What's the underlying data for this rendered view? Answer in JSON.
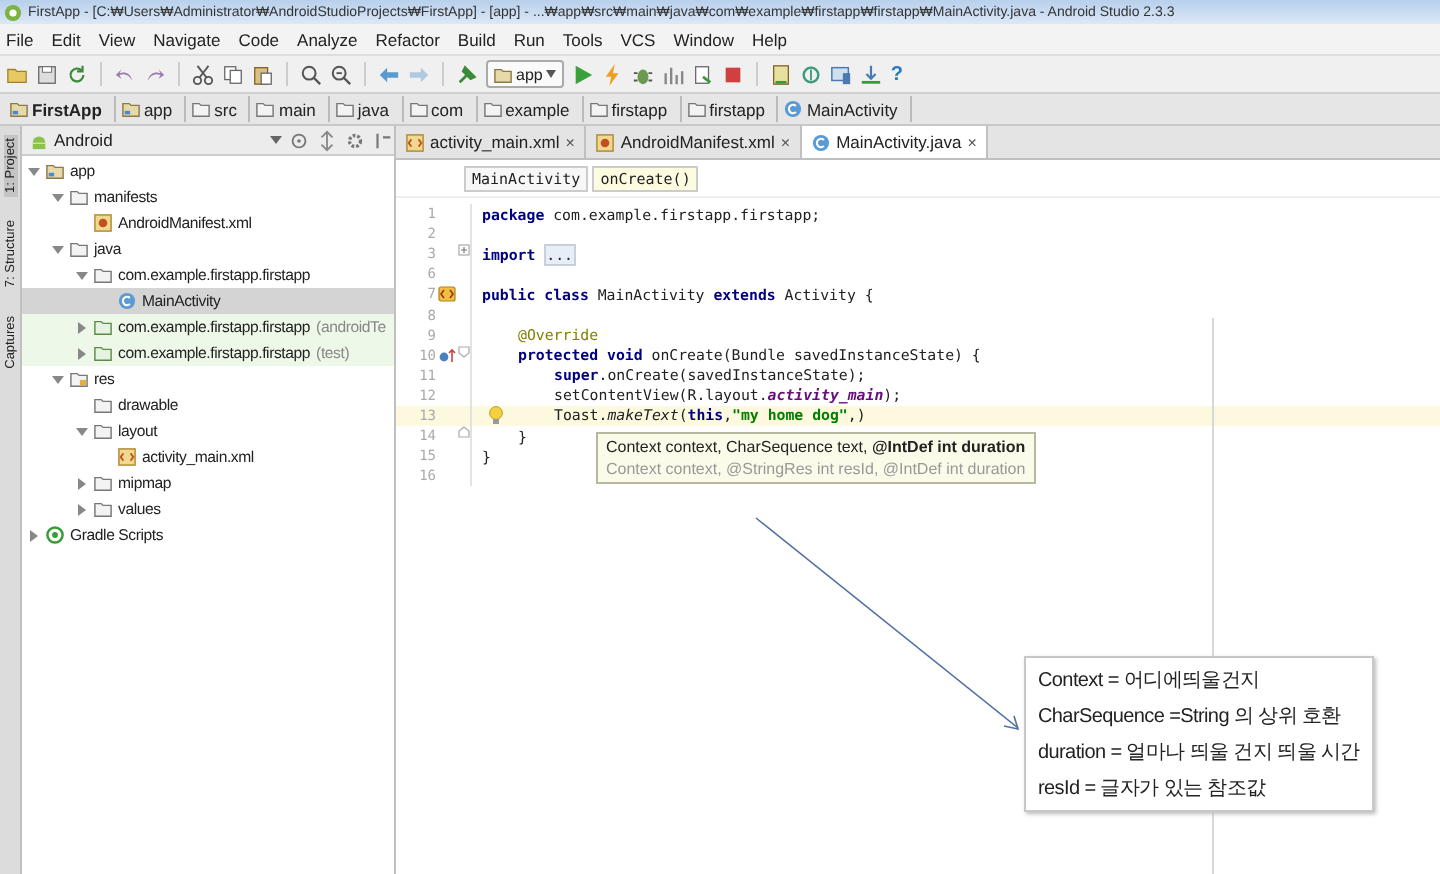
{
  "window": {
    "title": "FirstApp - [C:₩Users₩Administrator₩AndroidStudioProjects₩FirstApp] - [app] - ...₩app₩src₩main₩java₩com₩example₩firstapp₩firstapp₩MainActivity.java - Android Studio 2.3.3"
  },
  "menu": [
    "File",
    "Edit",
    "View",
    "Navigate",
    "Code",
    "Analyze",
    "Refactor",
    "Build",
    "Run",
    "Tools",
    "VCS",
    "Window",
    "Help"
  ],
  "toolbar": {
    "run_config": "app",
    "help": "?"
  },
  "breadcrumb": [
    {
      "label": "FirstApp",
      "kind": "module"
    },
    {
      "label": "app",
      "kind": "module"
    },
    {
      "label": "src",
      "kind": "folder"
    },
    {
      "label": "main",
      "kind": "folder"
    },
    {
      "label": "java",
      "kind": "folder"
    },
    {
      "label": "com",
      "kind": "folder"
    },
    {
      "label": "example",
      "kind": "folder"
    },
    {
      "label": "firstapp",
      "kind": "folder"
    },
    {
      "label": "firstapp",
      "kind": "folder"
    },
    {
      "label": "MainActivity",
      "kind": "class"
    }
  ],
  "side_tabs": [
    {
      "label": "1: Project",
      "selected": true
    },
    {
      "label": "7: Structure",
      "selected": false
    },
    {
      "label": "Captures",
      "selected": false
    }
  ],
  "project": {
    "view": "Android",
    "tree": [
      {
        "label": "app",
        "kind": "module",
        "expanded": true,
        "selected": false,
        "children": [
          {
            "label": "manifests",
            "kind": "folder",
            "expanded": true,
            "selected": false,
            "children": [
              {
                "label": "AndroidManifest.xml",
                "kind": "manifest",
                "selected": false
              }
            ]
          },
          {
            "label": "java",
            "kind": "folder",
            "expanded": true,
            "selected": false,
            "children": [
              {
                "label": "com.example.firstapp.firstapp",
                "kind": "folder",
                "expanded": true,
                "selected": false,
                "children": [
                  {
                    "label": "MainActivity",
                    "kind": "class",
                    "selected": true
                  }
                ]
              },
              {
                "label": "com.example.firstapp.firstapp",
                "suffix": "(androidTe",
                "kind": "test_folder",
                "expanded": false,
                "selected": false
              },
              {
                "label": "com.example.firstapp.firstapp",
                "suffix": "(test)",
                "kind": "test_folder",
                "expanded": false,
                "selected": false
              }
            ]
          },
          {
            "label": "res",
            "kind": "res_folder",
            "expanded": true,
            "selected": false,
            "children": [
              {
                "label": "drawable",
                "kind": "folder",
                "selected": false
              },
              {
                "label": "layout",
                "kind": "folder",
                "expanded": true,
                "selected": false,
                "children": [
                  {
                    "label": "activity_main.xml",
                    "kind": "layout",
                    "selected": false
                  }
                ]
              },
              {
                "label": "mipmap",
                "kind": "folder",
                "expanded": false,
                "selected": false
              },
              {
                "label": "values",
                "kind": "folder",
                "expanded": false,
                "selected": false
              }
            ]
          }
        ]
      },
      {
        "label": "Gradle Scripts",
        "kind": "gradle",
        "expanded": false,
        "selected": false
      }
    ]
  },
  "editor": {
    "tabs": [
      {
        "label": "activity_main.xml",
        "kind": "layout",
        "close": "×",
        "selected": false
      },
      {
        "label": "AndroidManifest.xml",
        "kind": "manifest",
        "close": "×",
        "selected": false
      },
      {
        "label": "MainActivity.java",
        "kind": "class",
        "close": "×",
        "selected": true
      }
    ],
    "crumbs": [
      "MainActivity",
      "onCreate()"
    ],
    "lines": [
      {
        "number": "1",
        "kind": "top",
        "tokens": [
          {
            "kind": "keyword",
            "text": "package"
          },
          {
            "kind": "plain",
            "text": " com.example.firstapp.firstapp;"
          }
        ]
      },
      {
        "number": "2"
      },
      {
        "number": "3",
        "kind": "top",
        "fold": {
          "kind": "plus"
        },
        "tokens": [
          {
            "kind": "keyword",
            "text": "import "
          },
          {
            "kind": "folded",
            "text": "..."
          }
        ]
      },
      {
        "number": "6"
      },
      {
        "number": "7",
        "kind": "top",
        "gutter": {
          "kind": "class"
        },
        "tokens": [
          {
            "kind": "keyword",
            "text": "public class"
          },
          {
            "kind": "plain",
            "text": " MainActivity "
          },
          {
            "kind": "keyword",
            "text": "extends"
          },
          {
            "kind": "plain",
            "text": " Activity {"
          }
        ]
      },
      {
        "number": "8"
      },
      {
        "number": "9",
        "kind": "member",
        "tokens": [
          {
            "kind": "annotation",
            "text": "@Override"
          }
        ]
      },
      {
        "number": "10",
        "kind": "member",
        "gutter": {
          "kind": "override"
        },
        "fold": {
          "kind": "open"
        },
        "tokens": [
          {
            "kind": "keyword",
            "text": "protected void"
          },
          {
            "kind": "plain",
            "text": " onCreate(Bundle savedInstanceState) {"
          }
        ]
      },
      {
        "number": "11",
        "kind": "body",
        "tokens": [
          {
            "kind": "keyword",
            "text": "super"
          },
          {
            "kind": "plain",
            "text": ".onCreate(savedInstanceState);"
          }
        ]
      },
      {
        "number": "12",
        "kind": "body",
        "tokens": [
          {
            "kind": "plain",
            "text": "setContentView(R.layout."
          },
          {
            "kind": "field",
            "text": "activity_main"
          },
          {
            "kind": "plain",
            "text": ");"
          }
        ]
      },
      {
        "number": "13",
        "kind": "body",
        "current": true,
        "bulb": true,
        "tokens": [
          {
            "kind": "plain",
            "text": "Toast."
          },
          {
            "kind": "static",
            "text": "makeText"
          },
          {
            "kind": "plain",
            "text": "("
          },
          {
            "kind": "keyword",
            "text": "this"
          },
          {
            "kind": "plain",
            "text": ","
          },
          {
            "kind": "string",
            "text": "\"my home dog\""
          },
          {
            "kind": "plain",
            "text": ",)"
          }
        ]
      },
      {
        "number": "14",
        "kind": "member",
        "fold": {
          "kind": "close"
        },
        "tokens": [
          {
            "kind": "plain",
            "text": "}"
          }
        ]
      },
      {
        "number": "15",
        "kind": "top",
        "tokens": [
          {
            "kind": "plain",
            "text": "}"
          }
        ]
      },
      {
        "number": "16"
      }
    ],
    "param_hint": [
      "Context context, CharSequence text, **@IntDef int duration**",
      "Context context, @StringRes int resId, @IntDef int duration"
    ]
  },
  "note": [
    "Context = 어디에띄울건지",
    "CharSequence =String 의 상위 호환",
    "duration = 얼마나 띄울 건지 띄울 시간",
    "resId = 글자가 있는 참조값"
  ]
}
